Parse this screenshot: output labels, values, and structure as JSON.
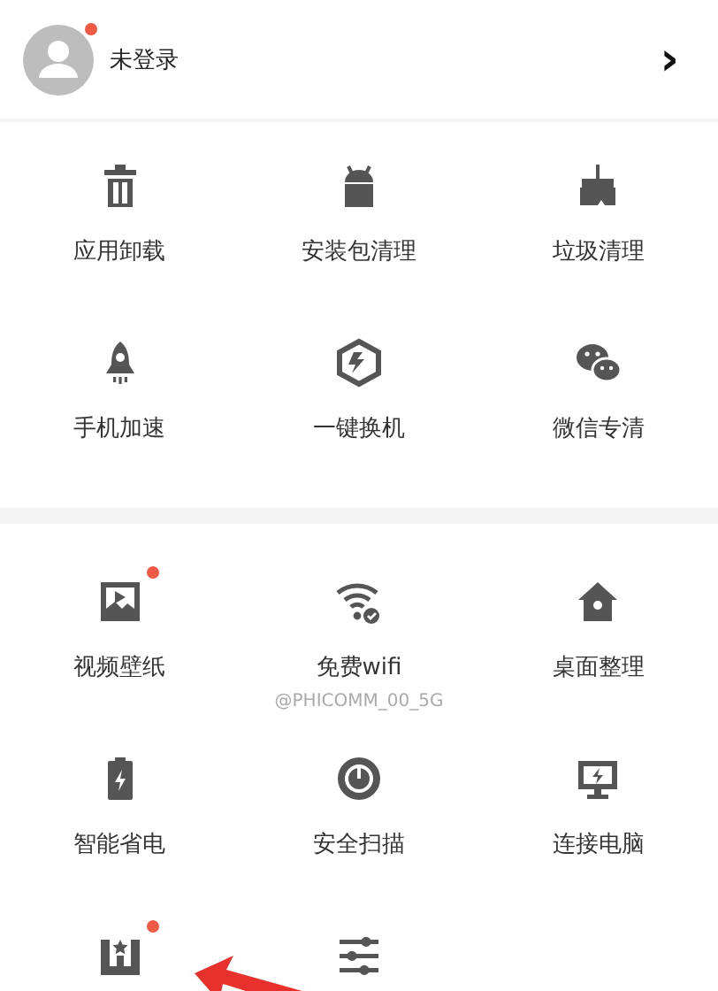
{
  "header": {
    "user_label": "未登录",
    "avatar_badge": true,
    "chevron": "›"
  },
  "sections": [
    {
      "items": [
        {
          "label": "应用卸载",
          "badge": false
        },
        {
          "label": "安装包清理",
          "badge": false
        },
        {
          "label": "垃圾清理",
          "badge": false
        },
        {
          "label": "手机加速",
          "badge": false
        },
        {
          "label": "一键换机",
          "badge": false
        },
        {
          "label": "微信专清",
          "badge": false
        }
      ]
    },
    {
      "items": [
        {
          "label": "视频壁纸",
          "badge": true
        },
        {
          "label": "免费wifi",
          "sub": "@PHICOMM_00_5G",
          "badge": false
        },
        {
          "label": "桌面整理",
          "badge": false
        },
        {
          "label": "智能省电",
          "badge": false
        },
        {
          "label": "安全扫描",
          "badge": false
        },
        {
          "label": "连接电脑",
          "badge": false
        },
        {
          "badge": true
        },
        {
          "badge": false
        }
      ]
    }
  ]
}
